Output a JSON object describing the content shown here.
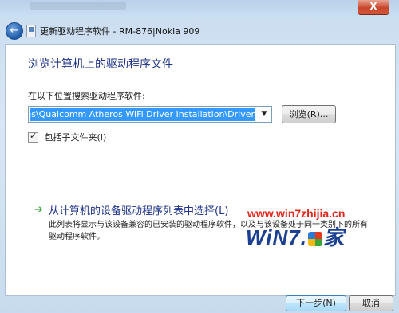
{
  "window": {
    "title": "更新驱动程序软件 - RM-876|Nokia 909",
    "close_label": "X"
  },
  "page": {
    "heading": "浏览计算机上的驱动程序文件",
    "search_label": "在以下位置搜索驱动程序软件:",
    "path_value": "C:\\Program Files\\Qualcomm Atheros WiFi Driver Installation\\Driver",
    "browse_label": "浏览(R)...",
    "include_subfolders_label": "包括子文件夹(I)",
    "include_subfolders_checked": true
  },
  "pick_option": {
    "title": "从计算机的设备驱动程序列表中选择(L)",
    "description": "此列表将显示与该设备兼容的已安装的驱动程序软件，以及与该设备处于同一类别下的所有驱动程序软件。"
  },
  "footer": {
    "next_label": "下一步(N)",
    "cancel_label": "取消"
  },
  "watermark": {
    "url": "www.win7zhijia.cn",
    "logo_left": "WiN7.",
    "logo_right": "家"
  }
}
